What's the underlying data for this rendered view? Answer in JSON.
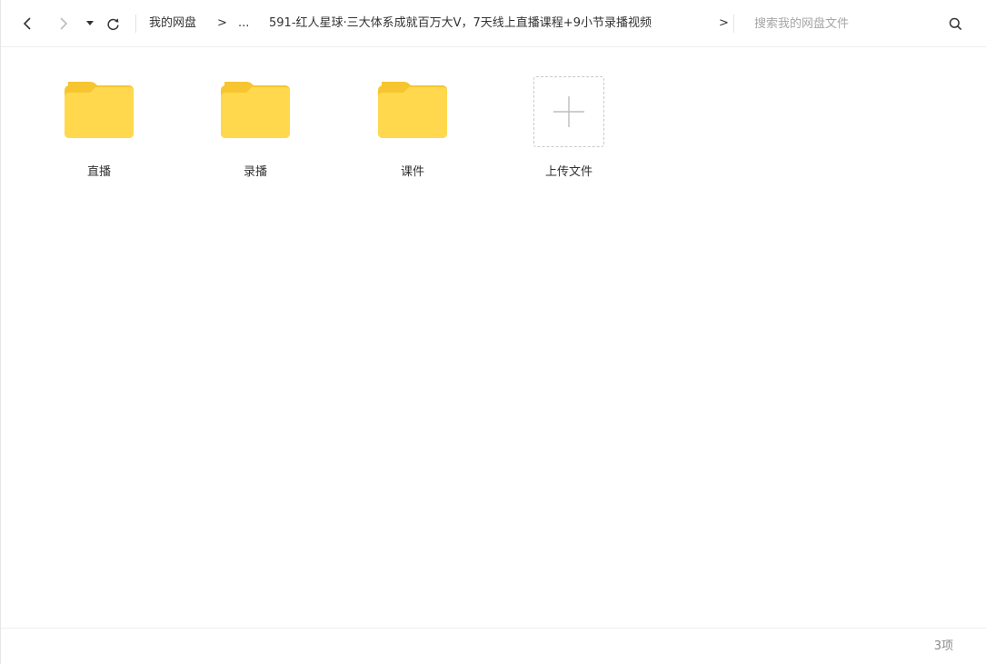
{
  "navbar": {
    "back_icon": "chevron-left-icon",
    "forward_icon": "chevron-right-icon",
    "history_icon": "caret-down-icon",
    "refresh_icon": "refresh-icon",
    "breadcrumb": {
      "root": "我的网盘",
      "sep": ">",
      "ellipsis": "...",
      "current": "591-红人星球·三大体系成就百万大V，7天线上直播课程+9小节录播视频",
      "more": ">"
    },
    "search": {
      "placeholder": "搜索我的网盘文件",
      "value": "",
      "icon": "search-icon"
    }
  },
  "content": {
    "folders": [
      {
        "name": "直播",
        "icon": "folder-icon"
      },
      {
        "name": "录播",
        "icon": "folder-icon"
      },
      {
        "name": "课件",
        "icon": "folder-icon"
      }
    ],
    "upload": {
      "label": "上传文件",
      "icon": "plus-icon"
    }
  },
  "footer": {
    "item_count": "3项"
  },
  "colors": {
    "folder_body": "#ffd84d",
    "folder_tab": "#f7c52f",
    "border": "#eeeeee",
    "muted_text": "#888888"
  }
}
